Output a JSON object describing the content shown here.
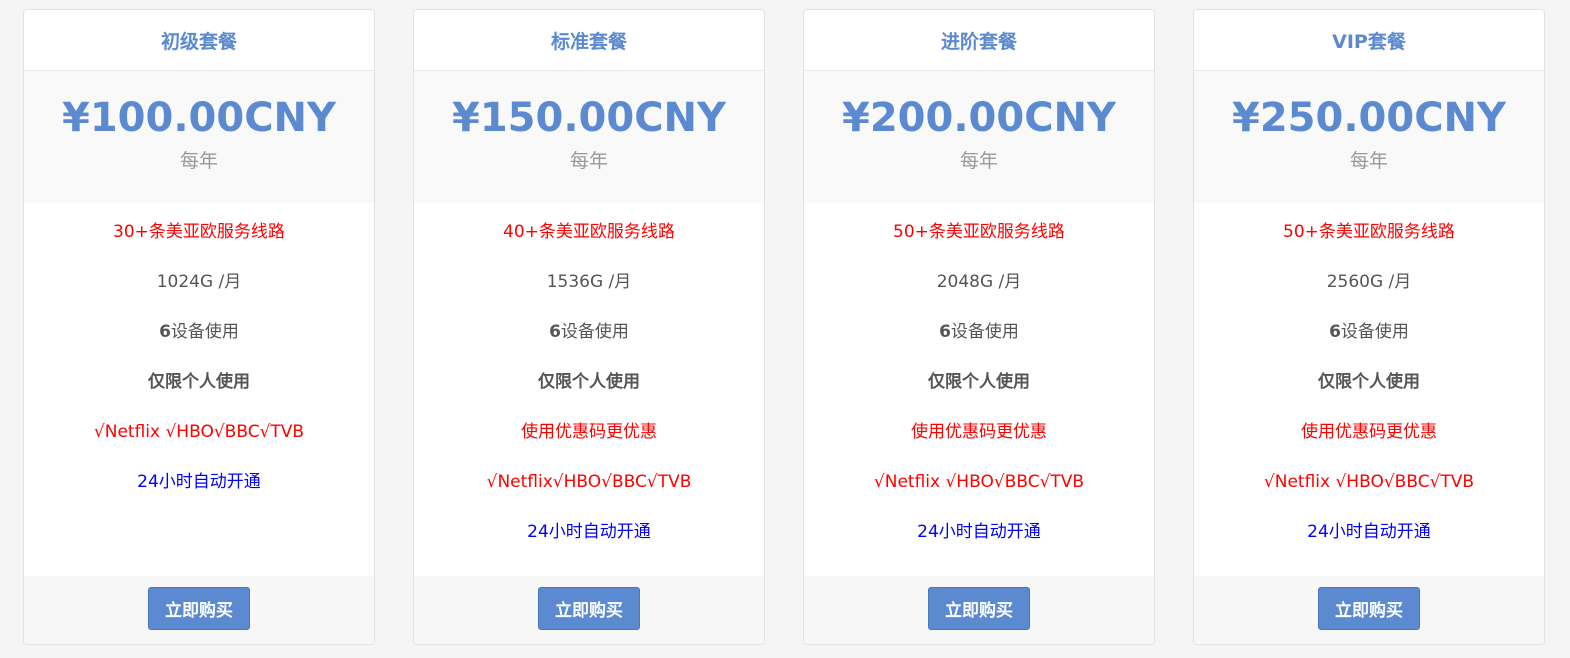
{
  "buy_label": "立即购买",
  "colors": {
    "accent": "#5b8ad0",
    "feature_red": "#ff0000",
    "feature_blue": "#0000ff",
    "text_gray": "#555555"
  },
  "plans": [
    {
      "name": "初级套餐",
      "price": "¥100.00CNY",
      "period": "每年",
      "routes": "30+条美亚欧服务线路",
      "traffic": "1024G /月",
      "devices_num": "6",
      "devices_text": "设备使用",
      "personal": "仅限个人使用",
      "streaming": "√Netflix √HBO√BBC√TVB",
      "activation": "24小时自动开通"
    },
    {
      "name": "标准套餐",
      "price": "¥150.00CNY",
      "period": "每年",
      "routes": "40+条美亚欧服务线路",
      "traffic": "1536G /月",
      "devices_num": "6",
      "devices_text": "设备使用",
      "personal": "仅限个人使用",
      "coupon": "使用优惠码更优惠",
      "streaming": "√Netflix√HBO√BBC√TVB",
      "activation": "24小时自动开通"
    },
    {
      "name": "进阶套餐",
      "price": "¥200.00CNY",
      "period": "每年",
      "routes": "50+条美亚欧服务线路",
      "traffic": "2048G /月",
      "devices_num": "6",
      "devices_text": "设备使用",
      "personal": "仅限个人使用",
      "coupon": "使用优惠码更优惠",
      "streaming": "√Netflix √HBO√BBC√TVB",
      "activation": "24小时自动开通"
    },
    {
      "name": "VIP套餐",
      "price": "¥250.00CNY",
      "period": "每年",
      "routes": "50+条美亚欧服务线路",
      "traffic": "2560G /月",
      "devices_num": "6",
      "devices_text": "设备使用",
      "personal": "仅限个人使用",
      "coupon": "使用优惠码更优惠",
      "streaming": "√Netflix √HBO√BBC√TVB",
      "activation": "24小时自动开通"
    }
  ]
}
